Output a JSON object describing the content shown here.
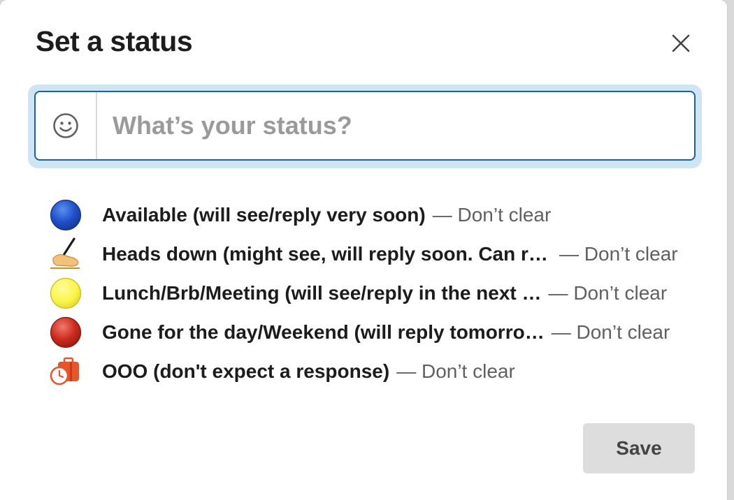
{
  "dialog": {
    "title": "Set a status",
    "close_icon": "close-icon"
  },
  "input": {
    "placeholder": "What’s your status?",
    "value": "",
    "emoji_icon": "smiley-face-icon"
  },
  "presets": [
    {
      "icon": "blue-circle-emoji",
      "label": "Available (will see/reply very soon)",
      "clear": "— Don’t clear",
      "color": "#2451c4"
    },
    {
      "icon": "writing-hand-emoji",
      "label": "Heads down (might see, will reply soon. Can re…",
      "clear": "— Don’t clear",
      "color": "#f3c17a"
    },
    {
      "icon": "yellow-circle-emoji",
      "label": "Lunch/Brb/Meeting (will see/reply in the next …",
      "clear": "— Don’t clear",
      "color": "#fbf54a"
    },
    {
      "icon": "red-circle-emoji",
      "label": "Gone for the day/Weekend (will reply tomorro…",
      "clear": "— Don’t clear",
      "color": "#c8281c"
    },
    {
      "icon": "luggage-clock-emoji",
      "label": "OOO (don't expect a response)",
      "clear": "— Don’t clear",
      "color": "#e8552b"
    }
  ],
  "footer": {
    "save_label": "Save"
  },
  "colors": {
    "accent_border": "#1264a3",
    "focus_ring": "#cfe5f3",
    "save_bg": "#dddddd"
  }
}
